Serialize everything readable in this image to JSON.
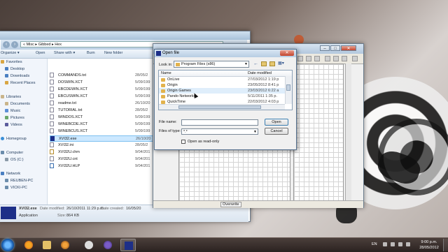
{
  "explorer": {
    "breadcrumb": "« Misc ▸ Gibbed ▸ Hex",
    "toolbar": [
      "Organize ▾",
      "Open",
      "Share with ▾",
      "Burn",
      "New folder"
    ],
    "nav": [
      {
        "label": "Favorites"
      },
      {
        "label": "Desktop"
      },
      {
        "label": "Downloads"
      },
      {
        "label": "Recent Places"
      },
      {
        "label": "Libraries"
      },
      {
        "label": "Documents"
      },
      {
        "label": "Music"
      },
      {
        "label": "Pictures"
      },
      {
        "label": "Videos"
      },
      {
        "label": "Homegroup"
      },
      {
        "label": "Computer"
      },
      {
        "label": "OS (C:)"
      },
      {
        "label": "Network"
      },
      {
        "label": "REUBEN-PC"
      },
      {
        "label": "VICKI-PC"
      }
    ],
    "files": [
      {
        "name": "COMMANDS.txt",
        "date": "28/05/2"
      },
      {
        "name": "DOSWIN.XCT",
        "date": "5/09/199"
      },
      {
        "name": "EBCDEWIN.XCT",
        "date": "5/09/199"
      },
      {
        "name": "EBCUSWIN.XCT",
        "date": "5/09/199"
      },
      {
        "name": "readme.txt",
        "date": "26/10/20"
      },
      {
        "name": "TUTORIAL.txt",
        "date": "28/05/2"
      },
      {
        "name": "WINDOS.XCT",
        "date": "5/09/199"
      },
      {
        "name": "WINEBCDE.XCT",
        "date": "5/09/199"
      },
      {
        "name": "WINEBCUS.XCT",
        "date": "5/09/199"
      },
      {
        "name": "XVI32.exe",
        "date": "26/10/20"
      },
      {
        "name": "XVI32.ini",
        "date": "28/05/2"
      },
      {
        "name": "XVI32U.chm",
        "date": "9/04/201"
      },
      {
        "name": "XVI32U.cnt",
        "date": "9/04/201"
      },
      {
        "name": "XVI32U.HLP",
        "date": "9/04/201"
      }
    ],
    "details": {
      "name": "XVI32.exe",
      "type": "Application",
      "modified_label": "Date modified:",
      "modified": "26/10/2011 11:29 p.m.",
      "created_label": "Date created:",
      "created": "16/05/20",
      "size_label": "Size:",
      "size": "864 KB"
    }
  },
  "hex_editor": {
    "status_mode": "Overwrite"
  },
  "dialog": {
    "title": "Open file",
    "close": "✕",
    "look_in_label": "Look in:",
    "look_in_value": "Program Files (x86)",
    "columns": [
      "Name",
      "Date modified"
    ],
    "rows": [
      {
        "name": "OnLive",
        "date": "27/03/2012 1:19 p"
      },
      {
        "name": "Origin",
        "date": "23/05/2012 8:41 p"
      },
      {
        "name": "Origin Games",
        "date": "23/03/2012 6:22 a",
        "hover": true
      },
      {
        "name": "Pando Networks",
        "date": "5/11/2011 1:35 p."
      },
      {
        "name": "QuickTime",
        "date": "22/03/2012 4:03 p"
      }
    ],
    "file_name_label": "File name:",
    "file_name_value": "",
    "file_type_label": "Files of type:",
    "file_type_value": "*.*",
    "open_button": "Open",
    "cancel_button": "Cancel",
    "readonly_label": "Open as read-only"
  },
  "taskbar": {
    "language": "EN",
    "time": "9:00 p.m.",
    "date": "28/05/2012"
  }
}
